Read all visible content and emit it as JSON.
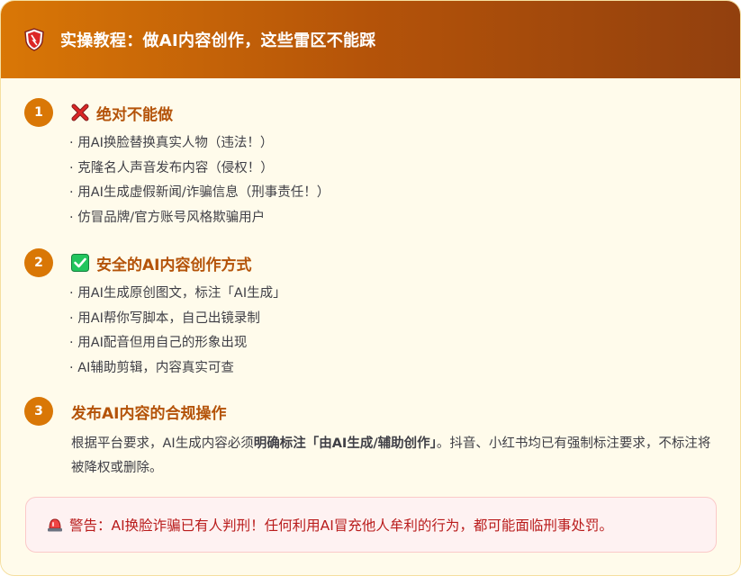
{
  "header": {
    "icon": "shield-icon",
    "title": "实操教程：做AI内容创作，这些雷区不能踩"
  },
  "sections": [
    {
      "number": "1",
      "icon": "cross-mark-icon",
      "title": "绝对不能做",
      "items": [
        "· 用AI换脸替换真实人物（违法！）",
        "· 克隆名人声音发布内容（侵权！）",
        "· 用AI生成虚假新闻/诈骗信息（刑事责任！）",
        "· 仿冒品牌/官方账号风格欺骗用户"
      ]
    },
    {
      "number": "2",
      "icon": "check-mark-icon",
      "title": "安全的AI内容创作方式",
      "items": [
        "· 用AI生成原创图文，标注「AI生成」",
        "· 用AI帮你写脚本，自己出镜录制",
        "· 用AI配音但用自己的形象出现",
        "· AI辅助剪辑，内容真实可查"
      ]
    },
    {
      "number": "3",
      "title": "发布AI内容的合规操作",
      "para_before": "根据平台要求，AI生成内容必须",
      "para_bold": "明确标注「由AI生成/辅助创作」",
      "para_after": "。抖音、小红书均已有强制标注要求，不标注将被降权或删除。"
    }
  ],
  "warning": {
    "icon": "siren-icon",
    "text": "警告：AI换脸诈骗已有人判刑！任何利用AI冒充他人牟利的行为，都可能面临刑事处罚。"
  },
  "colors": {
    "header_start": "#d97706",
    "header_end": "#92400e",
    "accent": "#b45309",
    "badge": "#d97706",
    "card_bg": "#fffbeb",
    "warning_bg": "#fef2f2",
    "warning_text": "#b91c1c"
  }
}
